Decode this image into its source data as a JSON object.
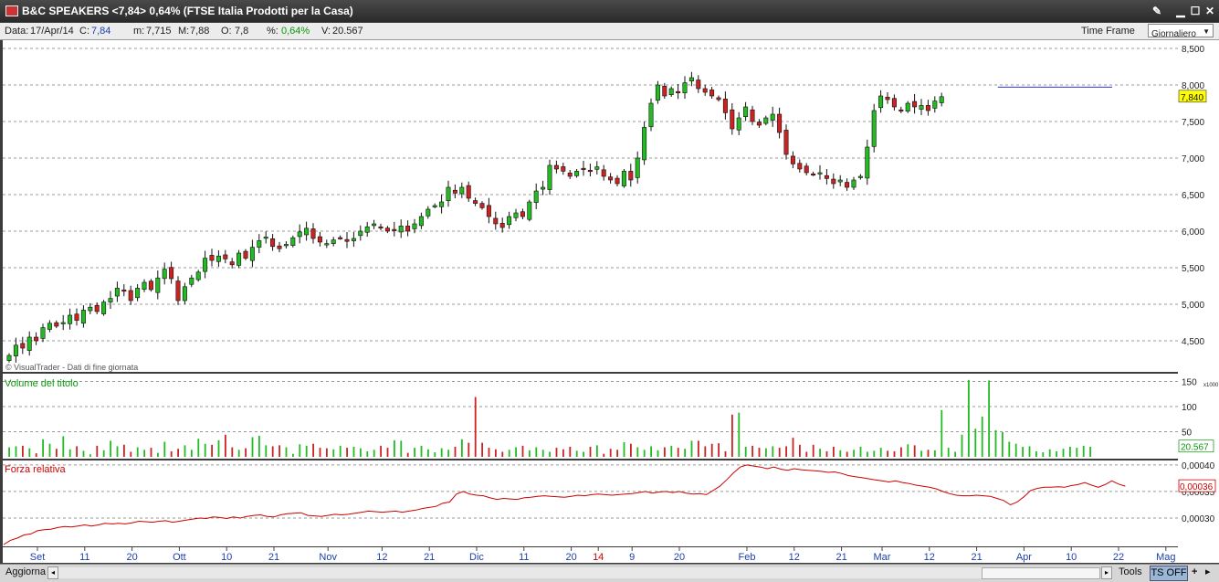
{
  "window": {
    "title": "B&C SPEAKERS <7,84> 0,64%  (FTSE Italia Prodotti per la Casa)"
  },
  "infobar": {
    "date_label": "Data:",
    "date_value": "17/Apr/14",
    "close_label": "C:",
    "close_value": "7,84",
    "min_label": "m:",
    "min_value": "7,715",
    "max_label": "M:",
    "max_value": "7,88",
    "open_label": "O:",
    "open_value": "7,8",
    "pct_label": "%:",
    "pct_value": "0,64%",
    "vol_label": "V:",
    "vol_value": "20.567",
    "timeframe_label": "Time Frame",
    "timeframe_value": "Giornaliero"
  },
  "bottombar": {
    "refresh_label": "Aggiorna",
    "tools_label": "Tools",
    "ts_label": "TS OFF",
    "plus": "+",
    "arrow": "▸"
  },
  "chart_data": [
    {
      "type": "candlestick",
      "panel": "price",
      "watermark": "© VisualTrader - Dati di fine giornata",
      "ylim": [
        4.3,
        8.55
      ],
      "yticks": [
        "8,500",
        "8,000",
        "7,500",
        "7,000",
        "6,500",
        "6,000",
        "5,500",
        "5,000",
        "4,500"
      ],
      "last_value_label": "7,840",
      "last_value": 7.84,
      "resistance_line": 7.97,
      "colors": {
        "up": "#22bb22",
        "down": "#cc2222",
        "last": "#ffff00"
      },
      "x_ticks": [
        {
          "label": "Set",
          "i": 5
        },
        {
          "label": "11",
          "i": 12
        },
        {
          "label": "20",
          "i": 19
        },
        {
          "label": "Ott",
          "i": 26
        },
        {
          "label": "10",
          "i": 33
        },
        {
          "label": "21",
          "i": 40
        },
        {
          "label": "Nov",
          "i": 48
        },
        {
          "label": "12",
          "i": 56
        },
        {
          "label": "21",
          "i": 63
        },
        {
          "label": "Dic",
          "i": 70
        },
        {
          "label": "11",
          "i": 77
        },
        {
          "label": "20",
          "i": 84
        },
        {
          "label": "14",
          "i": 88,
          "color": "#cc0000"
        },
        {
          "label": "9",
          "i": 93
        },
        {
          "label": "20",
          "i": 100
        },
        {
          "label": "Feb",
          "i": 110
        },
        {
          "label": "12",
          "i": 117
        },
        {
          "label": "21",
          "i": 124
        },
        {
          "label": "Mar",
          "i": 130
        },
        {
          "label": "12",
          "i": 137
        },
        {
          "label": "21",
          "i": 144
        },
        {
          "label": "Apr",
          "i": 151
        },
        {
          "label": "10",
          "i": 158
        },
        {
          "label": "22",
          "i": 165
        },
        {
          "label": "Mag",
          "i": 172
        }
      ],
      "closes": [
        4.3,
        4.44,
        4.4,
        4.55,
        4.5,
        4.68,
        4.74,
        4.7,
        4.75,
        4.85,
        4.78,
        4.92,
        4.96,
        4.9,
        5.03,
        5.08,
        5.22,
        5.18,
        5.05,
        5.22,
        5.3,
        5.2,
        5.36,
        5.48,
        5.35,
        5.05,
        5.24,
        5.36,
        5.44,
        5.63,
        5.6,
        5.66,
        5.62,
        5.54,
        5.7,
        5.63,
        5.78,
        5.87,
        5.92,
        5.79,
        5.76,
        5.82,
        5.91,
        5.99,
        6.04,
        5.9,
        5.85,
        5.83,
        5.88,
        5.91,
        5.86,
        5.9,
        6.0,
        6.06,
        6.1,
        6.05,
        6.0,
        6.02,
        6.07,
        6.0,
        6.1,
        6.2,
        6.3,
        6.35,
        6.4,
        6.6,
        6.52,
        6.6,
        6.45,
        6.38,
        6.32,
        6.2,
        6.1,
        6.05,
        6.2,
        6.25,
        6.2,
        6.4,
        6.55,
        6.6,
        6.9,
        6.85,
        6.82,
        6.75,
        6.82,
        6.85,
        6.83,
        6.88,
        6.75,
        6.7,
        6.65,
        6.82,
        6.7,
        7.0,
        7.42,
        7.75,
        8.0,
        7.85,
        7.95,
        7.9,
        8.03,
        8.1,
        7.95,
        7.9,
        7.85,
        7.8,
        7.62,
        7.4,
        7.55,
        7.7,
        7.5,
        7.45,
        7.55,
        7.6,
        7.35,
        7.05,
        6.92,
        6.85,
        6.8,
        6.78,
        6.8,
        6.72,
        6.65,
        6.7,
        6.6,
        6.7,
        6.75,
        7.15,
        7.65,
        7.85,
        7.8,
        7.7,
        7.65,
        7.75,
        7.7,
        7.72,
        7.65,
        7.78,
        7.84
      ],
      "volume_panel": {
        "title": "Volume del titolo",
        "ylim": [
          0,
          160
        ],
        "yticks": [
          "150",
          "100",
          "50"
        ],
        "multiplier_label": "x1000",
        "last_value_label": "20.567",
        "last_value": 20.567,
        "values": [
          19,
          21,
          22,
          17,
          7,
          35,
          26,
          16,
          41,
          15,
          21,
          12,
          5,
          22,
          13,
          32,
          21,
          24,
          10,
          19,
          14,
          18,
          8,
          30,
          11,
          16,
          23,
          14,
          36,
          26,
          24,
          33,
          44,
          19,
          14,
          17,
          39,
          42,
          23,
          21,
          23,
          19,
          6,
          25,
          22,
          26,
          18,
          17,
          15,
          22,
          18,
          20,
          17,
          11,
          14,
          22,
          18,
          33,
          32,
          8,
          18,
          22,
          15,
          9,
          17,
          14,
          20,
          35,
          28,
          119,
          28,
          18,
          15,
          10,
          14,
          19,
          22,
          13,
          19,
          14,
          10,
          18,
          15,
          20,
          12,
          10,
          20,
          23,
          6,
          16,
          14,
          29,
          26,
          19,
          14,
          21,
          13,
          19,
          22,
          18,
          16,
          32,
          32,
          21,
          26,
          27,
          11,
          84,
          88,
          20,
          22,
          18,
          17,
          21,
          18,
          21,
          38,
          24,
          10,
          24,
          16,
          11,
          20,
          13,
          10,
          14,
          20,
          10,
          12,
          18,
          12,
          11,
          19,
          25,
          23,
          12,
          14,
          13,
          93,
          18,
          10,
          44,
          153,
          56,
          80,
          152,
          53,
          49,
          30,
          26,
          20,
          21,
          11,
          9,
          15,
          11,
          16,
          20,
          18,
          22,
          20
        ]
      },
      "rs_panel": {
        "title": "Forza relativa",
        "ylim": [
          0.00025,
          0.000405
        ],
        "yticks": [
          "0,00040",
          "0,00035",
          "0,00030"
        ],
        "last_value_label": "0,00036",
        "last_value": 0.00036,
        "colors": {
          "line": "#cc0000",
          "last_fill": "#ffffff"
        },
        "values": [
          0.00025,
          0.000258,
          0.000262,
          0.000268,
          0.00027,
          0.000276,
          0.000278,
          0.000279,
          0.000282,
          0.000284,
          0.000283,
          0.000285,
          0.000287,
          0.000285,
          0.000287,
          0.00029,
          0.000289,
          0.00029,
          0.000289,
          0.000291,
          0.000294,
          0.000293,
          0.000292,
          0.000294,
          0.000295,
          0.000292,
          0.000294,
          0.000296,
          0.000298,
          0.0003,
          0.000299,
          0.000302,
          0.000301,
          0.000299,
          0.000302,
          0.0003,
          0.000303,
          0.000305,
          0.000306,
          0.000303,
          0.000302,
          0.000306,
          0.000308,
          0.000309,
          0.00031,
          0.000305,
          0.000304,
          0.000303,
          0.000305,
          0.000307,
          0.000306,
          0.000307,
          0.000309,
          0.000311,
          0.000313,
          0.000312,
          0.000311,
          0.000312,
          0.000313,
          0.000311,
          0.000313,
          0.000315,
          0.000318,
          0.00032,
          0.000322,
          0.000328,
          0.00033,
          0.000345,
          0.00035,
          0.000345,
          0.000343,
          0.000342,
          0.000338,
          0.000335,
          0.000337,
          0.000336,
          0.000335,
          0.000338,
          0.000339,
          0.000341,
          0.000342,
          0.000341,
          0.00034,
          0.000339,
          0.000341,
          0.000343,
          0.000342,
          0.000344,
          0.000345,
          0.000344,
          0.000343,
          0.000344,
          0.000345,
          0.000346,
          0.000348,
          0.00035,
          0.000347,
          0.000349,
          0.00035,
          0.000348,
          0.00035,
          0.000347,
          0.000345,
          0.000346,
          0.000344,
          0.000352,
          0.00036,
          0.000372,
          0.000385,
          0.000396,
          0.0004,
          0.000398,
          0.000396,
          0.000393,
          0.000396,
          0.000392,
          0.00039,
          0.000393,
          0.000391,
          0.00039,
          0.000389,
          0.000388,
          0.000386,
          0.000387,
          0.000384,
          0.00038,
          0.000378,
          0.000376,
          0.000374,
          0.000372,
          0.00037,
          0.000368,
          0.00037,
          0.000367,
          0.000365,
          0.000362,
          0.00036,
          0.000358,
          0.000355,
          0.00035,
          0.000346,
          0.000343,
          0.000342,
          0.000342,
          0.000343,
          0.000342,
          0.000341,
          0.000337,
          0.000333,
          0.000325,
          0.00033,
          0.00034,
          0.000352,
          0.000356,
          0.000358,
          0.000358,
          0.000359,
          0.000358,
          0.000361,
          0.000363,
          0.000367,
          0.000362,
          0.000358,
          0.000363,
          0.00037,
          0.000364,
          0.00036
        ]
      }
    }
  ]
}
